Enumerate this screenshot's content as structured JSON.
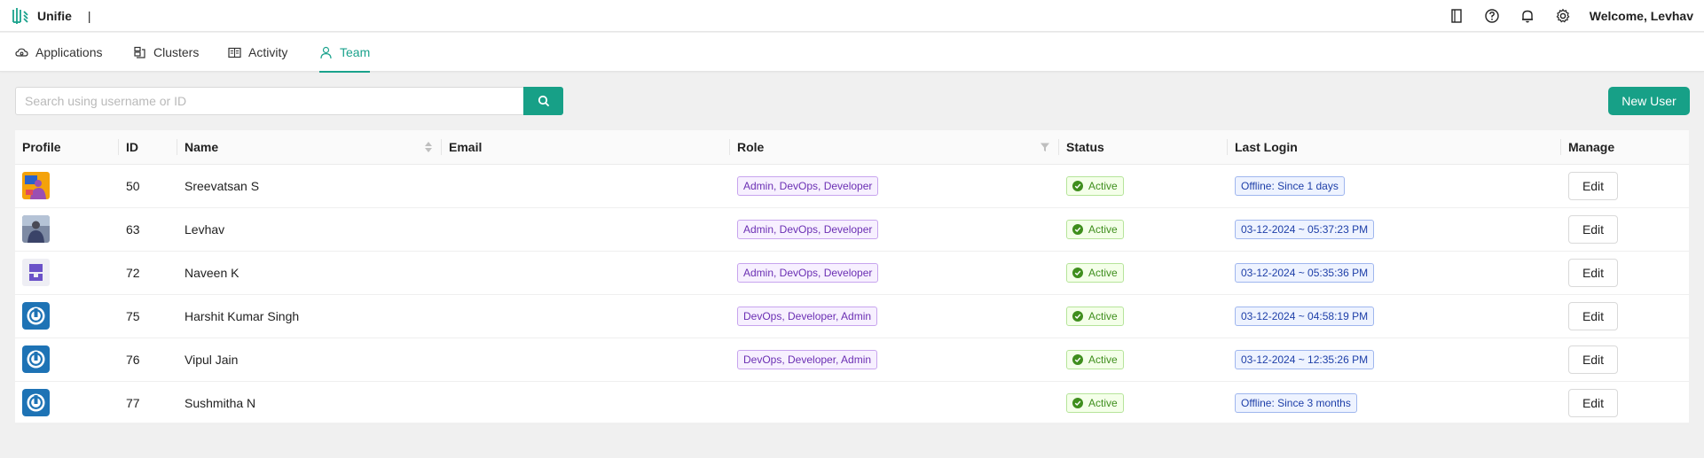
{
  "app": {
    "name": "Unifie",
    "divider": "|"
  },
  "header": {
    "icons": [
      "book-icon",
      "help-icon",
      "bell-icon",
      "gear-icon"
    ],
    "welcome": "Welcome, Levhav"
  },
  "tabs": [
    {
      "label": "Applications",
      "icon": "cloud-icon"
    },
    {
      "label": "Clusters",
      "icon": "cluster-icon"
    },
    {
      "label": "Activity",
      "icon": "activity-icon"
    },
    {
      "label": "Team",
      "icon": "user-icon",
      "active": true
    }
  ],
  "search": {
    "placeholder": "Search using username or ID",
    "value": ""
  },
  "new_user_label": "New User",
  "table": {
    "columns": [
      "Profile",
      "ID",
      "Name",
      "Email",
      "Role",
      "Status",
      "Last Login",
      "Manage"
    ],
    "rows": [
      {
        "avatar": "photo-orange",
        "id": "50",
        "name": "Sreevatsan S",
        "email": "",
        "role": "Admin, DevOps, Developer",
        "status": "Active",
        "last_login": "Offline: Since 1 days",
        "manage": "Edit"
      },
      {
        "avatar": "photo-person",
        "id": "63",
        "name": "Levhav",
        "email": "",
        "role": "Admin, DevOps, Developer",
        "status": "Active",
        "last_login": "03-12-2024 ~ 05:37:23 PM",
        "manage": "Edit"
      },
      {
        "avatar": "identicon-purple",
        "id": "72",
        "name": "Naveen K",
        "email": "",
        "role": "Admin, DevOps, Developer",
        "status": "Active",
        "last_login": "03-12-2024 ~ 05:35:36 PM",
        "manage": "Edit"
      },
      {
        "avatar": "power-blue",
        "id": "75",
        "name": "Harshit Kumar Singh",
        "email": "",
        "role": "DevOps, Developer, Admin",
        "status": "Active",
        "last_login": "03-12-2024 ~ 04:58:19 PM",
        "manage": "Edit"
      },
      {
        "avatar": "power-blue",
        "id": "76",
        "name": "Vipul Jain",
        "email": "",
        "role": "DevOps, Developer, Admin",
        "status": "Active",
        "last_login": "03-12-2024 ~ 12:35:26 PM",
        "manage": "Edit"
      },
      {
        "avatar": "power-blue",
        "id": "77",
        "name": "Sushmitha N",
        "email": "",
        "role": "",
        "status": "Active",
        "last_login": "Offline: Since 3 months",
        "manage": "Edit"
      }
    ]
  },
  "colors": {
    "accent": "#17a087",
    "role_tag": "#6b2fb3",
    "status_tag": "#3f8e1d",
    "login_tag": "#1e3fa8"
  }
}
